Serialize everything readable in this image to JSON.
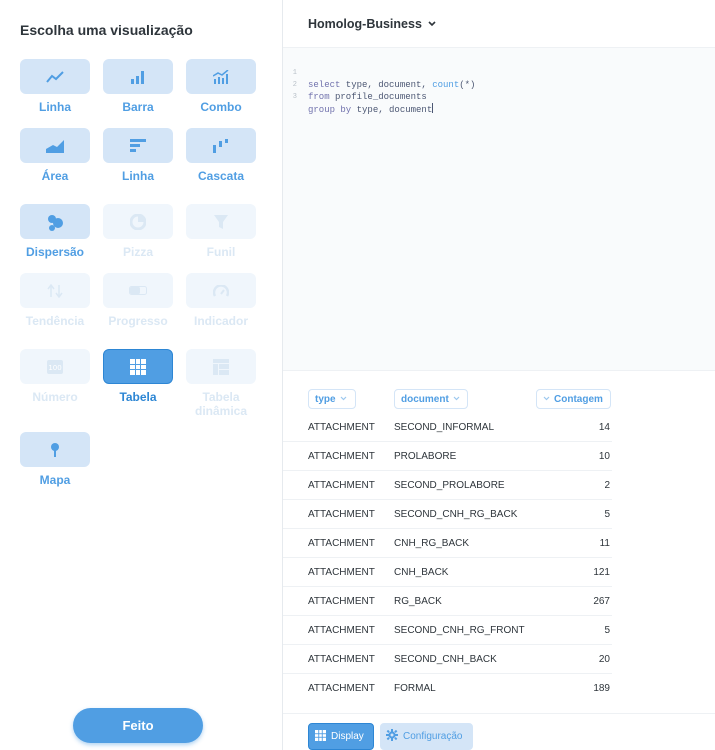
{
  "sidebar": {
    "title": "Escolha uma visualização",
    "done_label": "Feito",
    "viz_types": [
      {
        "label": "Linha",
        "icon": "line-chart-icon",
        "state": "enabled"
      },
      {
        "label": "Barra",
        "icon": "bar-chart-icon",
        "state": "enabled"
      },
      {
        "label": "Combo",
        "icon": "combo-chart-icon",
        "state": "enabled"
      },
      {
        "label": "Área",
        "icon": "area-chart-icon",
        "state": "enabled"
      },
      {
        "label": "Linha",
        "icon": "row-chart-icon",
        "state": "enabled"
      },
      {
        "label": "Cascata",
        "icon": "waterfall-chart-icon",
        "state": "enabled"
      },
      {
        "label": "Dispersão",
        "icon": "scatter-chart-icon",
        "state": "enabled"
      },
      {
        "label": "Pizza",
        "icon": "pie-chart-icon",
        "state": "disabled"
      },
      {
        "label": "Funil",
        "icon": "funnel-icon",
        "state": "disabled"
      },
      {
        "label": "Tendência",
        "icon": "trend-arrows-icon",
        "state": "disabled"
      },
      {
        "label": "Progresso",
        "icon": "progress-icon",
        "state": "disabled"
      },
      {
        "label": "Indicador",
        "icon": "gauge-icon",
        "state": "disabled"
      },
      {
        "label": "Número",
        "icon": "number-icon",
        "state": "disabled"
      },
      {
        "label": "Tabela",
        "icon": "table-icon",
        "state": "selected"
      },
      {
        "label": "Tabela dinâmica",
        "icon": "pivot-table-icon",
        "state": "disabled"
      },
      {
        "label": "Mapa",
        "icon": "map-pin-icon",
        "state": "enabled"
      }
    ]
  },
  "header": {
    "database": "Homolog-Business"
  },
  "editor": {
    "lines": [
      {
        "num": "1",
        "text": "select type, document, count(*)"
      },
      {
        "num": "2",
        "text": "from profile_documents"
      },
      {
        "num": "3",
        "text": "group by type, document"
      }
    ]
  },
  "table": {
    "columns": [
      "type",
      "document",
      "Contagem"
    ],
    "rows": [
      [
        "ATTACHMENT",
        "SECOND_INFORMAL",
        "14"
      ],
      [
        "ATTACHMENT",
        "PROLABORE",
        "10"
      ],
      [
        "ATTACHMENT",
        "SECOND_PROLABORE",
        "2"
      ],
      [
        "ATTACHMENT",
        "SECOND_CNH_RG_BACK",
        "5"
      ],
      [
        "ATTACHMENT",
        "CNH_RG_BACK",
        "11"
      ],
      [
        "ATTACHMENT",
        "CNH_BACK",
        "121"
      ],
      [
        "ATTACHMENT",
        "RG_BACK",
        "267"
      ],
      [
        "ATTACHMENT",
        "SECOND_CNH_RG_FRONT",
        "5"
      ],
      [
        "ATTACHMENT",
        "SECOND_CNH_BACK",
        "20"
      ],
      [
        "ATTACHMENT",
        "FORMAL",
        "189"
      ]
    ]
  },
  "footer": {
    "display_label": "Display",
    "config_label": "Configuração"
  },
  "colors": {
    "accent": "#509ee3",
    "tile_bg": "#d4e5f7",
    "disabled": "#dbe8f4"
  }
}
